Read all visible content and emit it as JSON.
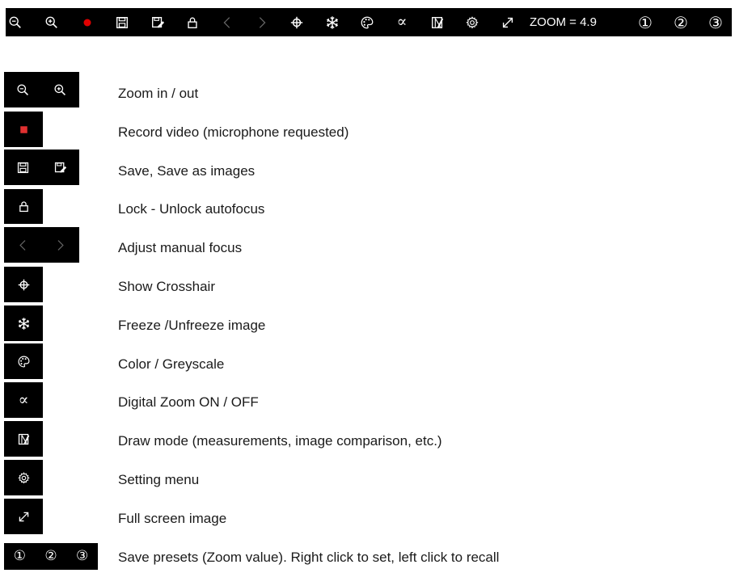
{
  "toolbar": {
    "zoom_readout": "ZOOM = 4.9",
    "presets": [
      "①",
      "②",
      "③"
    ]
  },
  "alpha_symbol": "∝",
  "legend": [
    {
      "label": "Zoom in / out",
      "icons": [
        "zoom-out-icon",
        "zoom-in-icon"
      ]
    },
    {
      "label": "Record video (microphone requested)",
      "icons": [
        "record-stop-icon"
      ]
    },
    {
      "label": "Save, Save as images",
      "icons": [
        "save-icon",
        "save-as-icon"
      ]
    },
    {
      "label": "Lock - Unlock autofocus",
      "icons": [
        "lock-icon"
      ]
    },
    {
      "label": "Adjust manual focus",
      "icons": [
        "chevron-left-icon",
        "chevron-right-icon"
      ]
    },
    {
      "label": "Show Crosshair",
      "icons": [
        "crosshair-icon"
      ]
    },
    {
      "label": "Freeze /Unfreeze image",
      "icons": [
        "snowflake-icon"
      ]
    },
    {
      "label": "Color / Greyscale",
      "icons": [
        "palette-icon"
      ]
    },
    {
      "label": "Digital Zoom ON / OFF",
      "icons": [
        "alpha-icon"
      ]
    },
    {
      "label": "Draw mode (measurements, image comparison, etc.)",
      "icons": [
        "draw-mode-icon"
      ]
    },
    {
      "label": "Setting menu",
      "icons": [
        "gear-icon"
      ]
    },
    {
      "label": "Full screen image",
      "icons": [
        "fullscreen-icon"
      ]
    },
    {
      "label": "Save presets (Zoom value). Right click to set, left click to recall",
      "icons": [
        "preset-1-icon",
        "preset-2-icon",
        "preset-3-icon"
      ]
    }
  ],
  "colors": {
    "toolbar_bg": "#000000",
    "icon": "#ffffff",
    "record_toolbar": "#e00000",
    "record_legend": "#e03030",
    "disabled_icon": "#555555"
  }
}
